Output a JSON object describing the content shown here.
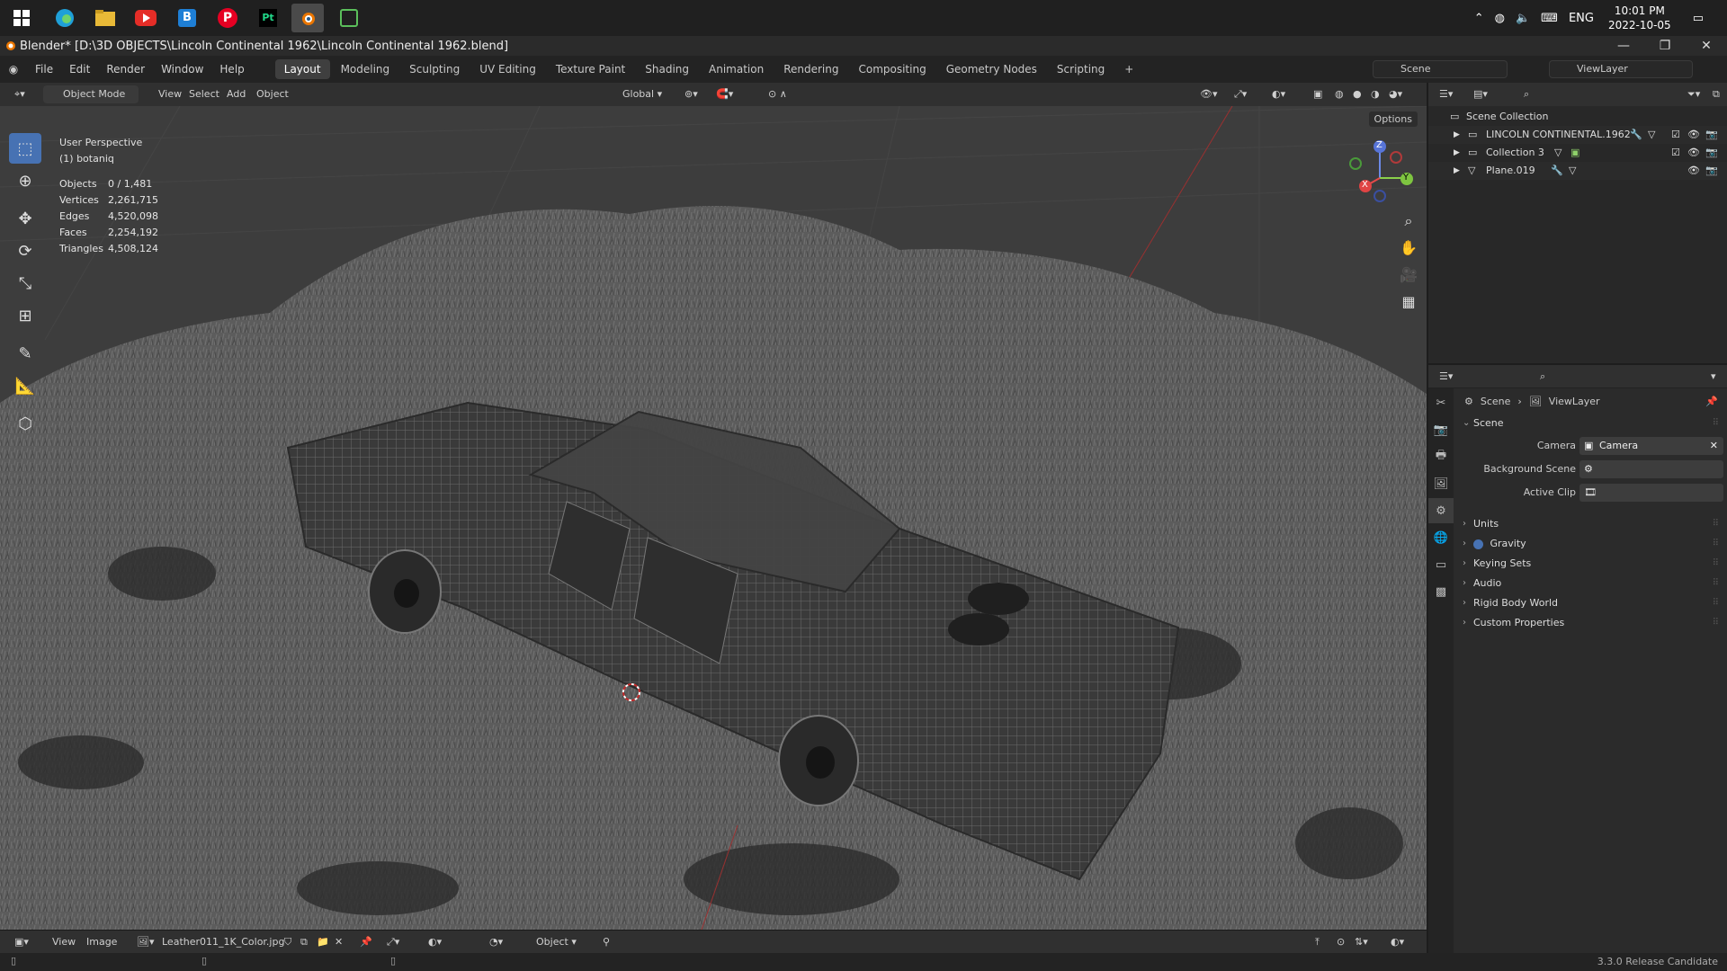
{
  "taskbar": {
    "apps": [
      {
        "name": "windows-start-icon"
      },
      {
        "name": "edge-icon"
      },
      {
        "name": "file-explorer-icon"
      },
      {
        "name": "youtube-icon"
      },
      {
        "name": "b-app-icon",
        "glyph": "B"
      },
      {
        "name": "pinterest-icon",
        "glyph": "P"
      },
      {
        "name": "pycharm-icon",
        "glyph": "Pt"
      },
      {
        "name": "blender-taskbar-icon"
      },
      {
        "name": "green-app-icon"
      }
    ],
    "tray": {
      "lang": "ENG",
      "time": "10:01 PM",
      "date": "2022-10-05"
    }
  },
  "titlebar": {
    "title": "Blender* [D:\\3D OBJECTS\\Lincoln Continental 1962\\Lincoln Continental 1962.blend]"
  },
  "menu": {
    "items": [
      "File",
      "Edit",
      "Render",
      "Window",
      "Help"
    ]
  },
  "workspaces": {
    "tabs": [
      "Layout",
      "Modeling",
      "Sculpting",
      "UV Editing",
      "Texture Paint",
      "Shading",
      "Animation",
      "Rendering",
      "Compositing",
      "Geometry Nodes",
      "Scripting"
    ],
    "active": "Layout",
    "add": "+"
  },
  "scene_field": "Scene",
  "viewlayer_field": "ViewLayer",
  "viewport_header": {
    "mode": "Object Mode",
    "menus": [
      "View",
      "Select",
      "Add",
      "Object"
    ],
    "transform": "Global",
    "options": "Options"
  },
  "viewport": {
    "perspective": "User Perspective",
    "active_object": "(1) botaniq",
    "stats": [
      {
        "label": "Objects",
        "value": "0 / 1,481"
      },
      {
        "label": "Vertices",
        "value": "2,261,715"
      },
      {
        "label": "Edges",
        "value": "4,520,098"
      },
      {
        "label": "Faces",
        "value": "2,254,192"
      },
      {
        "label": "Triangles",
        "value": "4,508,124"
      }
    ],
    "gizmo": {
      "x": "X",
      "y": "Y",
      "z": "Z"
    }
  },
  "image_header": {
    "menus": [
      "View",
      "Image"
    ],
    "image_name": "Leather011_1K_Color.jpg",
    "object_mode": "Object"
  },
  "status": {
    "version": "3.3.0 Release Candidate"
  },
  "outliner": {
    "root": "Scene Collection",
    "items": [
      "LINCOLN CONTINENTAL.1962",
      "Collection 3",
      "Plane.019"
    ]
  },
  "properties": {
    "breadcrumb": [
      "Scene",
      "ViewLayer"
    ],
    "panel": "Scene",
    "fields": [
      {
        "label": "Camera",
        "value": "Camera"
      },
      {
        "label": "Background Scene",
        "value": ""
      },
      {
        "label": "Active Clip",
        "value": ""
      }
    ],
    "subpanels": [
      "Units",
      "Gravity",
      "Keying Sets",
      "Audio",
      "Rigid Body World",
      "Custom Properties"
    ]
  }
}
